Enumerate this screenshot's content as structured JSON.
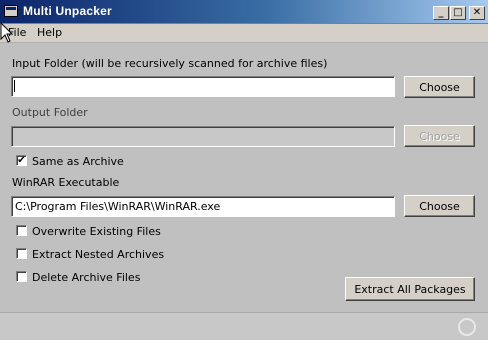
{
  "window": {
    "title": "Multi Unpacker",
    "minimize_glyph": "_",
    "maximize_glyph": "□",
    "close_glyph": "✕"
  },
  "menu": {
    "file": "File",
    "help": "Help"
  },
  "input_folder": {
    "label": "Input Folder (will be recursively scanned for archive files)",
    "value": "",
    "choose_label": "Choose"
  },
  "output_folder": {
    "label": "Output Folder",
    "value": "",
    "choose_label": "Choose",
    "enabled": false
  },
  "same_as_archive": {
    "label": "Same as Archive",
    "checked": true,
    "check_glyph": "✔"
  },
  "winrar": {
    "label": "WinRAR Executable",
    "value": "C:\\Program Files\\WinRAR\\WinRAR.exe",
    "choose_label": "Choose"
  },
  "options": {
    "overwrite": {
      "label": "Overwrite Existing Files",
      "checked": false
    },
    "nested": {
      "label": "Extract Nested Archives",
      "checked": false
    },
    "delete": {
      "label": "Delete Archive Files",
      "checked": false
    }
  },
  "actions": {
    "extract_all": "Extract All Packages"
  },
  "icons": {
    "app": "app-icon",
    "cursor": "mouse-pointer-icon",
    "gripper": "status-ring-icon"
  },
  "colors": {
    "titlebar_start": "#0a246a",
    "titlebar_end": "#a6caf0",
    "window_bg": "#c0c0c0"
  }
}
